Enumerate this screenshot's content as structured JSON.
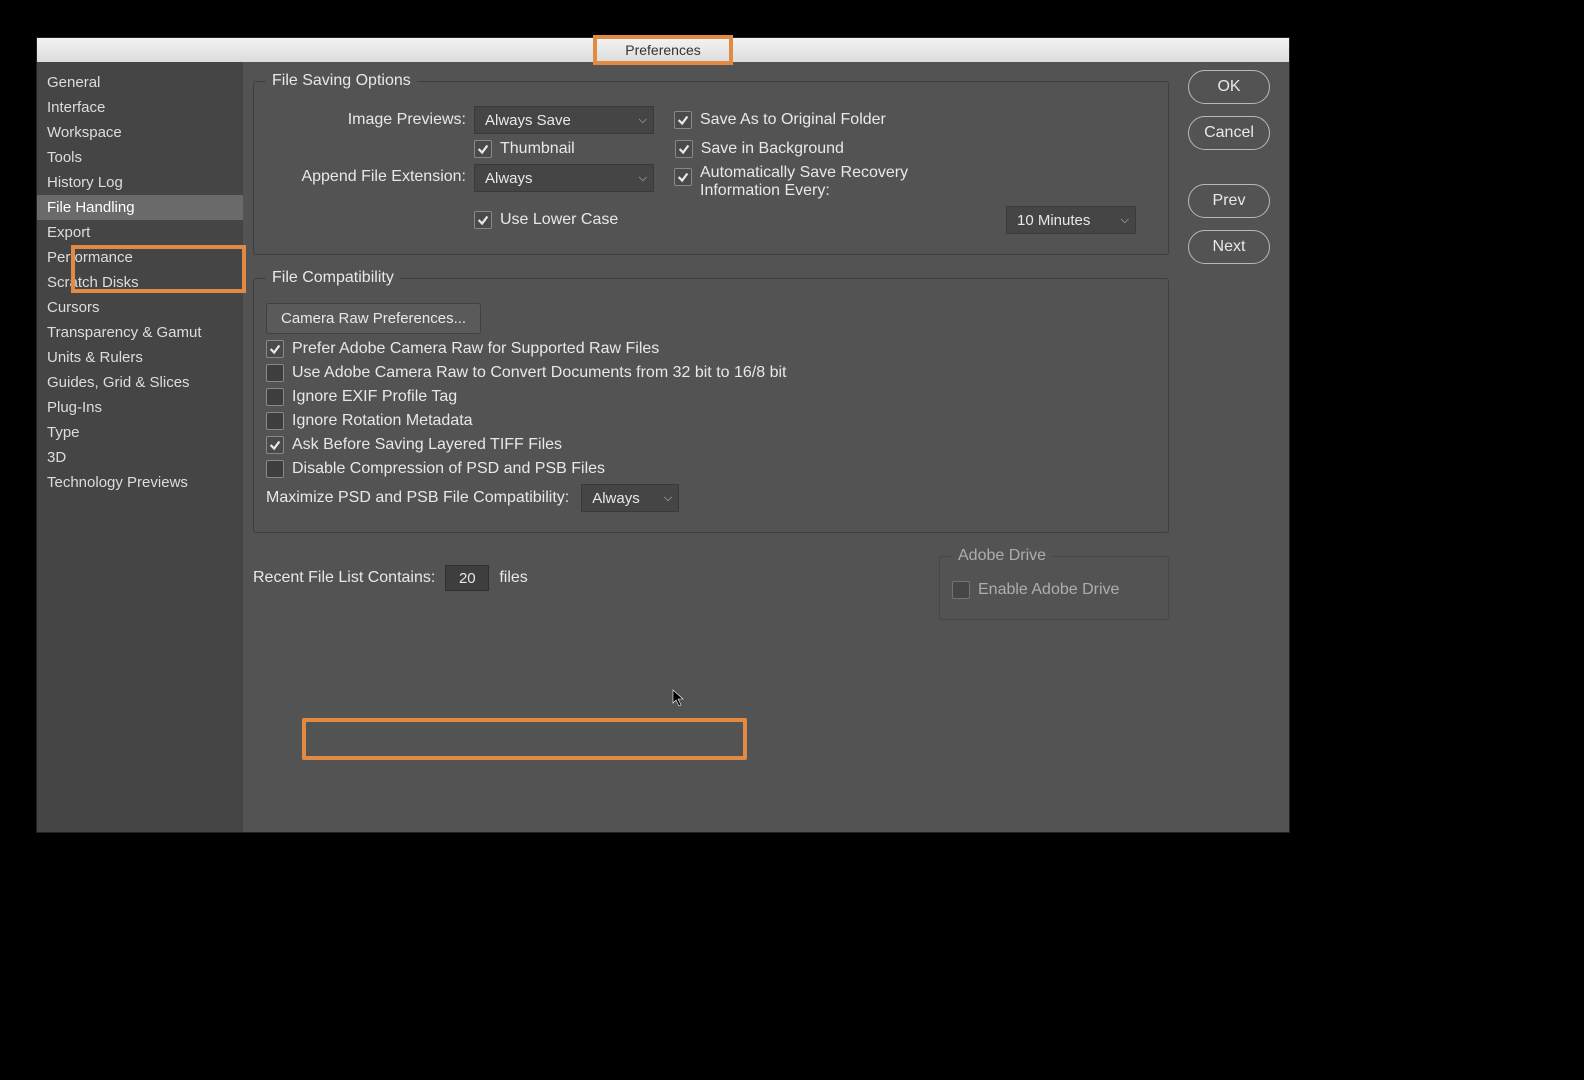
{
  "window": {
    "title": "Preferences"
  },
  "sidebar": {
    "items": [
      "General",
      "Interface",
      "Workspace",
      "Tools",
      "History Log",
      "File Handling",
      "Export",
      "Performance",
      "Scratch Disks",
      "Cursors",
      "Transparency & Gamut",
      "Units & Rulers",
      "Guides, Grid & Slices",
      "Plug-Ins",
      "Type",
      "3D",
      "Technology Previews"
    ],
    "active_index": 5
  },
  "buttons": {
    "ok": "OK",
    "cancel": "Cancel",
    "prev": "Prev",
    "next": "Next"
  },
  "file_saving": {
    "legend": "File Saving Options",
    "image_previews_label": "Image Previews:",
    "image_previews_value": "Always Save",
    "thumbnail_label": "Thumbnail",
    "save_as_original_label": "Save As to Original Folder",
    "save_background_label": "Save in Background",
    "append_ext_label": "Append File Extension:",
    "append_ext_value": "Always",
    "use_lower_label": "Use Lower Case",
    "auto_save_label": "Automatically Save Recovery Information Every:",
    "auto_save_interval": "10 Minutes"
  },
  "compat": {
    "legend": "File Compatibility",
    "camera_raw_btn": "Camera Raw Preferences...",
    "prefer_acr": "Prefer Adobe Camera Raw for Supported Raw Files",
    "use_acr_convert": "Use Adobe Camera Raw to Convert Documents from 32 bit to 16/8 bit",
    "ignore_exif": "Ignore EXIF Profile Tag",
    "ignore_rotation": "Ignore Rotation Metadata",
    "ask_tiff": "Ask Before Saving Layered TIFF Files",
    "disable_compress": "Disable Compression of PSD and PSB Files",
    "max_compat_label": "Maximize PSD and PSB File Compatibility:",
    "max_compat_value": "Always"
  },
  "recent": {
    "label": "Recent File List Contains:",
    "value": "20",
    "suffix": "files"
  },
  "adobe_drive": {
    "legend": "Adobe Drive",
    "enable_label": "Enable Adobe Drive"
  }
}
